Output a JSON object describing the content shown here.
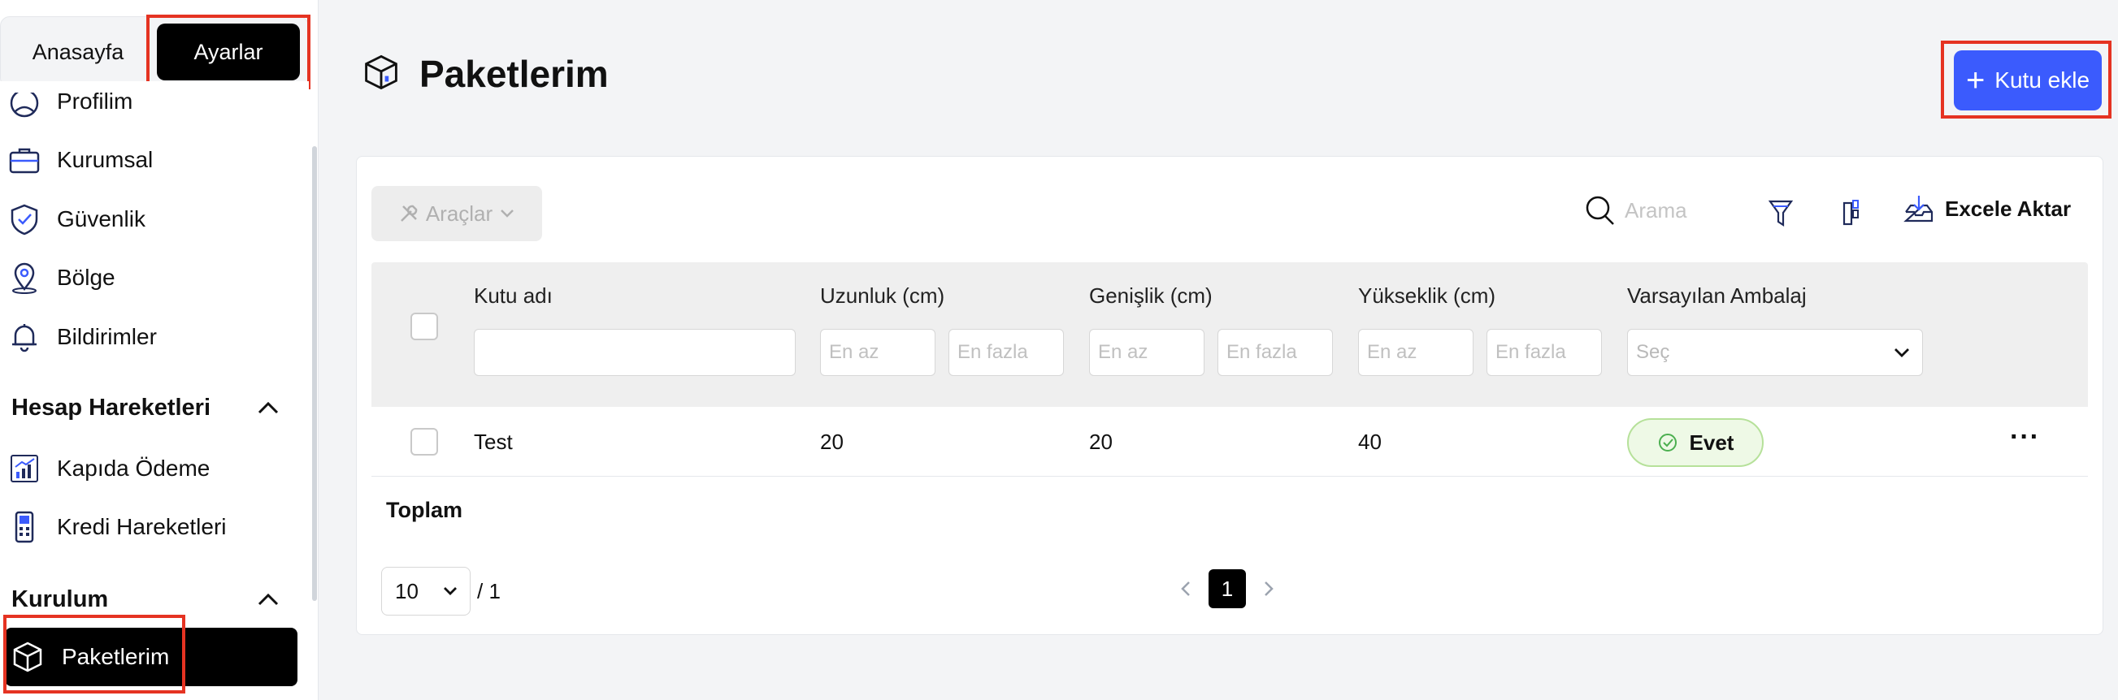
{
  "topnav": {
    "home_label": "Anasayfa",
    "settings_label": "Ayarlar"
  },
  "sidebar": {
    "items": [
      {
        "label": "Profilim",
        "icon": "profile-icon"
      },
      {
        "label": "Kurumsal",
        "icon": "briefcase-icon"
      },
      {
        "label": "Güvenlik",
        "icon": "shield-check-icon"
      },
      {
        "label": "Bölge",
        "icon": "map-pin-icon"
      },
      {
        "label": "Bildirimler",
        "icon": "bell-icon"
      }
    ],
    "section_account": "Hesap Hareketleri",
    "account_items": [
      {
        "label": "Kapıda Ödeme",
        "icon": "chart-icon"
      },
      {
        "label": "Kredi Hareketleri",
        "icon": "pos-terminal-icon"
      }
    ],
    "section_setup": "Kurulum",
    "active_item": {
      "label": "Paketlerim",
      "icon": "box-icon"
    }
  },
  "header": {
    "title": "Paketlerim",
    "add_button": "Kutu ekle"
  },
  "toolbar": {
    "tools_label": "Araçlar",
    "search_placeholder": "Arama",
    "export_label": "Excele Aktar"
  },
  "table": {
    "columns": [
      "Kutu adı",
      "Uzunluk (cm)",
      "Genişlik (cm)",
      "Yükseklik (cm)",
      "Varsayılan Ambalaj"
    ],
    "filter_min": "En az",
    "filter_max": "En fazla",
    "select_placeholder": "Seç",
    "rows": [
      {
        "name": "Test",
        "length": "20",
        "width": "20",
        "height": "40",
        "default": "Evet"
      }
    ]
  },
  "footer": {
    "total_label": "Toplam",
    "page_size": "10",
    "page_total": "/ 1",
    "current_page": "1"
  },
  "colors": {
    "accent": "#3b5bfd",
    "highlight": "#e53322",
    "badge_bg": "#eef9e6",
    "badge_border": "#b6e19a"
  }
}
